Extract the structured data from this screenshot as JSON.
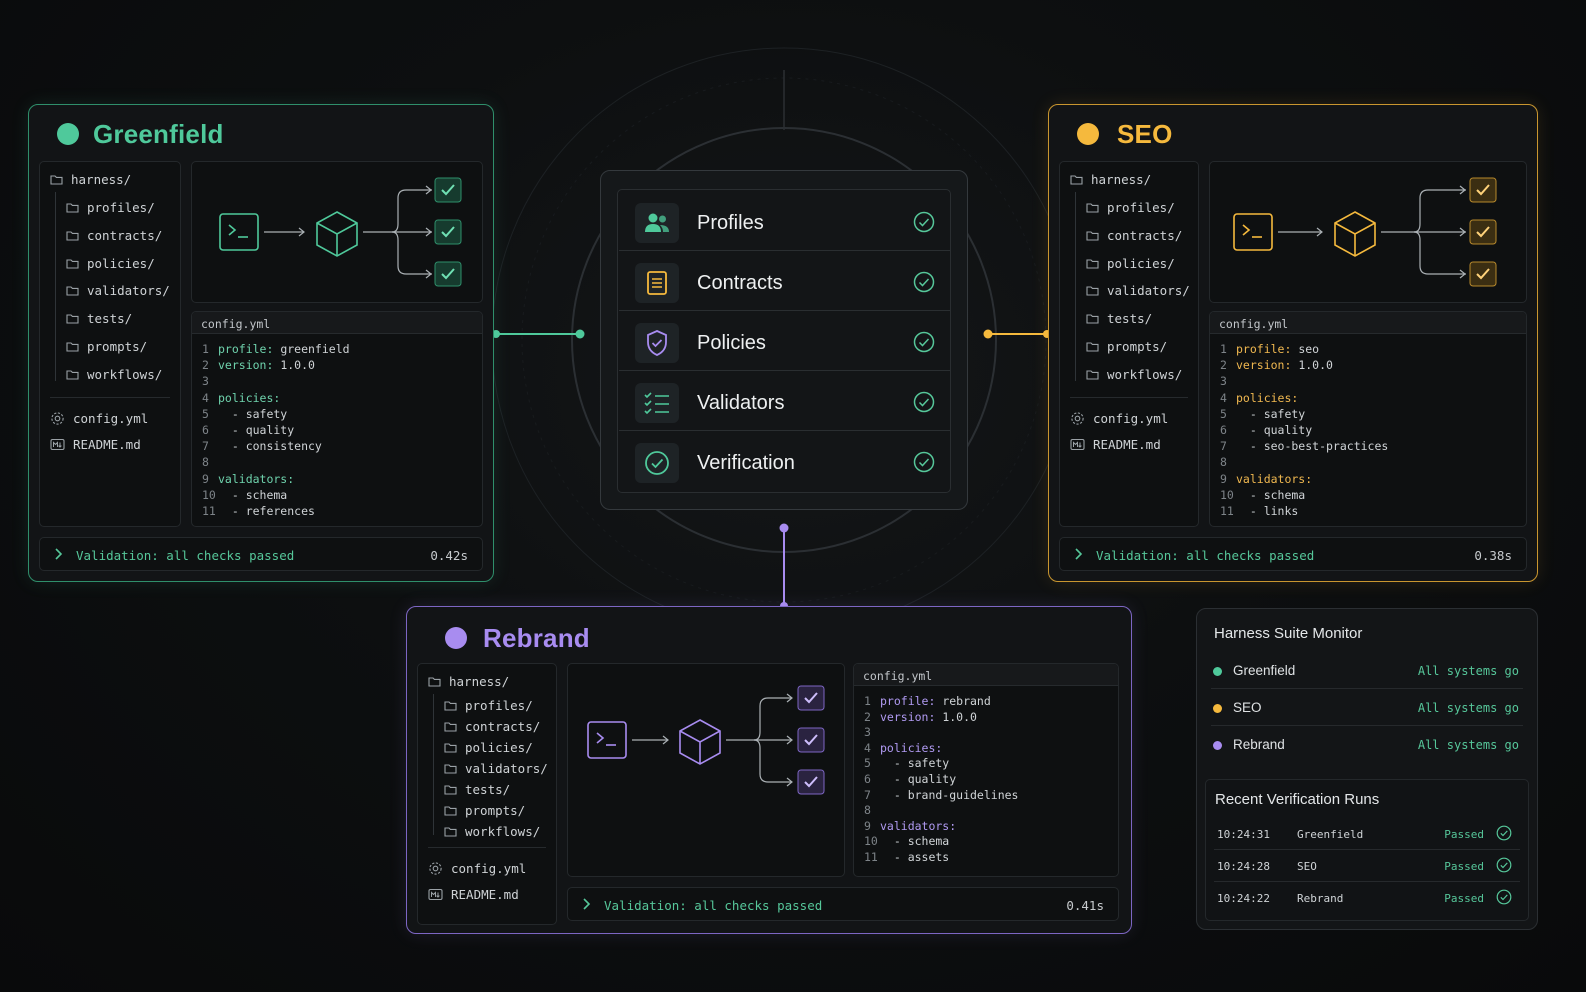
{
  "colors": {
    "greenfield": "#4fc99b",
    "seo": "#f5b93d",
    "rebrand": "#a88cf0",
    "success": "#56c79a",
    "code_key_green": "#6fd3ad",
    "code_key_orange": "#f0b850",
    "code_key_purple": "#b09af2"
  },
  "greenfield": {
    "title": "Greenfield",
    "tree": {
      "root": "harness/",
      "dirs": [
        "profiles/",
        "contracts/",
        "policies/",
        "validators/",
        "tests/",
        "prompts/",
        "workflows/"
      ],
      "files": [
        "config.yml",
        "README.md"
      ]
    },
    "code": {
      "filename": "config.yml",
      "lines": [
        {
          "n": "1",
          "k": "profile:",
          "v": " greenfield"
        },
        {
          "n": "2",
          "k": "version:",
          "v": " 1.0.0"
        },
        {
          "n": "3",
          "k": "",
          "v": ""
        },
        {
          "n": "4",
          "k": "policies:",
          "v": ""
        },
        {
          "n": "5",
          "k": "",
          "v": "  - safety"
        },
        {
          "n": "6",
          "k": "",
          "v": "  - quality"
        },
        {
          "n": "7",
          "k": "",
          "v": "  - consistency"
        },
        {
          "n": "8",
          "k": "",
          "v": ""
        },
        {
          "n": "9",
          "k": "validators:",
          "v": ""
        },
        {
          "n": "10",
          "k": "",
          "v": "  - schema"
        },
        {
          "n": "11",
          "k": "",
          "v": "  - references"
        }
      ]
    },
    "status": {
      "text": "Validation: all checks passed",
      "time": "0.42s"
    }
  },
  "seo": {
    "title": "SEO",
    "tree": {
      "root": "harness/",
      "dirs": [
        "profiles/",
        "contracts/",
        "policies/",
        "validators/",
        "tests/",
        "prompts/",
        "workflows/"
      ],
      "files": [
        "config.yml",
        "README.md"
      ]
    },
    "code": {
      "filename": "config.yml",
      "lines": [
        {
          "n": "1",
          "k": "profile:",
          "v": " seo"
        },
        {
          "n": "2",
          "k": "version:",
          "v": " 1.0.0"
        },
        {
          "n": "3",
          "k": "",
          "v": ""
        },
        {
          "n": "4",
          "k": "policies:",
          "v": ""
        },
        {
          "n": "5",
          "k": "",
          "v": "  - safety"
        },
        {
          "n": "6",
          "k": "",
          "v": "  - quality"
        },
        {
          "n": "7",
          "k": "",
          "v": "  - seo-best-practices"
        },
        {
          "n": "8",
          "k": "",
          "v": ""
        },
        {
          "n": "9",
          "k": "validators:",
          "v": ""
        },
        {
          "n": "10",
          "k": "",
          "v": "  - schema"
        },
        {
          "n": "11",
          "k": "",
          "v": "  - links"
        }
      ]
    },
    "status": {
      "text": "Validation: all checks passed",
      "time": "0.38s"
    }
  },
  "rebrand": {
    "title": "Rebrand",
    "tree": {
      "root": "harness/",
      "dirs": [
        "profiles/",
        "contracts/",
        "policies/",
        "validators/",
        "tests/",
        "prompts/",
        "workflows/"
      ],
      "files": [
        "config.yml",
        "README.md"
      ]
    },
    "code": {
      "filename": "config.yml",
      "lines": [
        {
          "n": "1",
          "k": "profile:",
          "v": " rebrand"
        },
        {
          "n": "2",
          "k": "version:",
          "v": " 1.0.0"
        },
        {
          "n": "3",
          "k": "",
          "v": ""
        },
        {
          "n": "4",
          "k": "policies:",
          "v": ""
        },
        {
          "n": "5",
          "k": "",
          "v": "  - safety"
        },
        {
          "n": "6",
          "k": "",
          "v": "  - quality"
        },
        {
          "n": "7",
          "k": "",
          "v": "  - brand-guidelines"
        },
        {
          "n": "8",
          "k": "",
          "v": ""
        },
        {
          "n": "9",
          "k": "validators:",
          "v": ""
        },
        {
          "n": "10",
          "k": "",
          "v": "  - schema"
        },
        {
          "n": "11",
          "k": "",
          "v": "  - assets"
        }
      ]
    },
    "status": {
      "text": "Validation: all checks passed",
      "time": "0.41s"
    }
  },
  "center": {
    "items": [
      {
        "label": "Profiles",
        "icon": "users-icon",
        "icon_color": "#4fc99b"
      },
      {
        "label": "Contracts",
        "icon": "document-icon",
        "icon_color": "#f5b93d"
      },
      {
        "label": "Policies",
        "icon": "shield-check-icon",
        "icon_color": "#a88cf0"
      },
      {
        "label": "Validators",
        "icon": "checklist-icon",
        "icon_color": "#4fc99b"
      },
      {
        "label": "Verification",
        "icon": "check-circle-icon",
        "icon_color": "#4fc99b"
      }
    ]
  },
  "monitor": {
    "title": "Harness Suite Monitor",
    "rows": [
      {
        "name": "Greenfield",
        "status": "All systems go",
        "color": "#4fc99b"
      },
      {
        "name": "SEO",
        "status": "All systems go",
        "color": "#f5b93d"
      },
      {
        "name": "Rebrand",
        "status": "All systems go",
        "color": "#a88cf0"
      }
    ],
    "runs_title": "Recent Verification Runs",
    "runs": [
      {
        "time": "10:24:31",
        "name": "Greenfield",
        "status": "Passed"
      },
      {
        "time": "10:24:28",
        "name": "SEO",
        "status": "Passed"
      },
      {
        "time": "10:24:22",
        "name": "Rebrand",
        "status": "Passed"
      }
    ]
  }
}
